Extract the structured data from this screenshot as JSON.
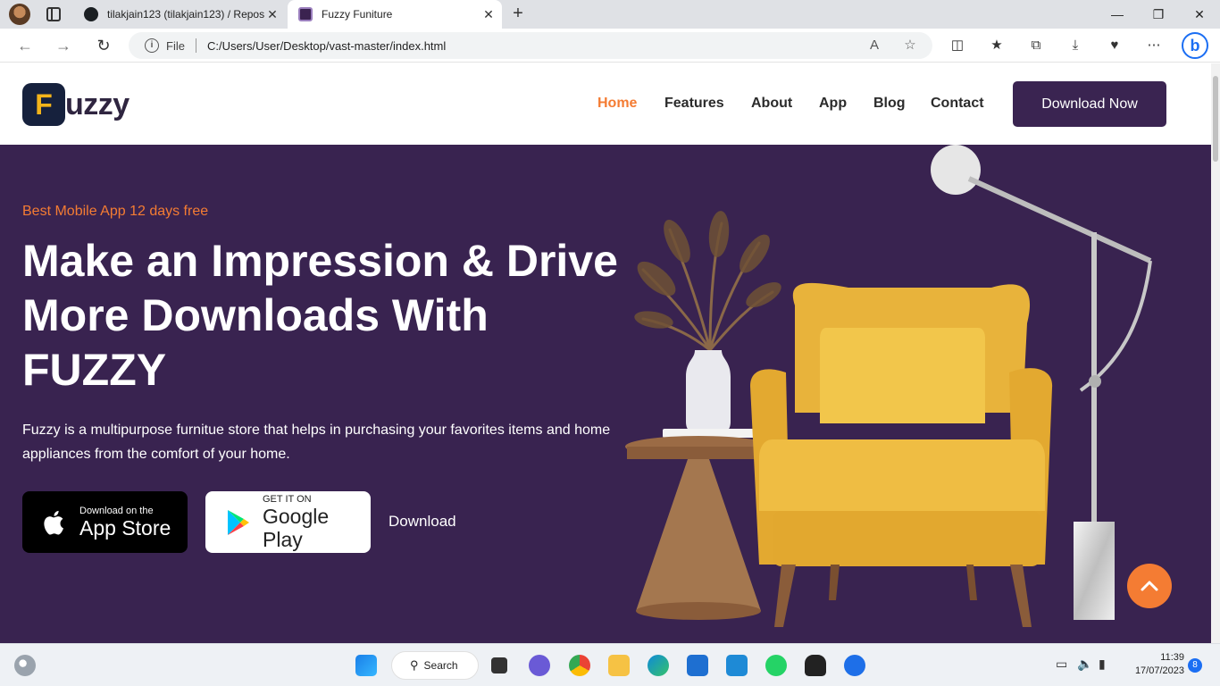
{
  "browser": {
    "tabs": [
      {
        "title": "tilakjain123 (tilakjain123) / Repos",
        "favicon": "github-icon"
      },
      {
        "title": "Fuzzy Funiture",
        "favicon": "fuzzy-favicon",
        "active": true
      }
    ],
    "address": {
      "scheme_label": "File",
      "url": "C:/Users/User/Desktop/vast-master/index.html"
    }
  },
  "site": {
    "logo": {
      "mark": "F",
      "text": "uzzy"
    },
    "nav": [
      {
        "label": "Home",
        "active": true
      },
      {
        "label": "Features"
      },
      {
        "label": "About"
      },
      {
        "label": "App"
      },
      {
        "label": "Blog"
      },
      {
        "label": "Contact"
      }
    ],
    "cta_label": "Download Now",
    "hero": {
      "eyebrow": "Best Mobile App 12 days free",
      "headline_lines": [
        "Make an Impression & Drive",
        "More Downloads With",
        "FUZZY"
      ],
      "description": "Fuzzy is a multipurpose furnitue store that helps in purchasing your favorites items and home appliances from the comfort of your home.",
      "app_store": {
        "small": "Download on the",
        "big": "App Store"
      },
      "google_play": {
        "small": "GET IT ON",
        "big": "Google Play"
      },
      "download_link": "Download"
    },
    "colors": {
      "brand_purple": "#392350",
      "accent_orange": "#f47c33",
      "logo_dark": "#16213d",
      "logo_yellow": "#f4b41a"
    }
  },
  "taskbar": {
    "search_label": "Search",
    "time": "11:39",
    "date": "17/07/2023",
    "notification_count": "8"
  }
}
